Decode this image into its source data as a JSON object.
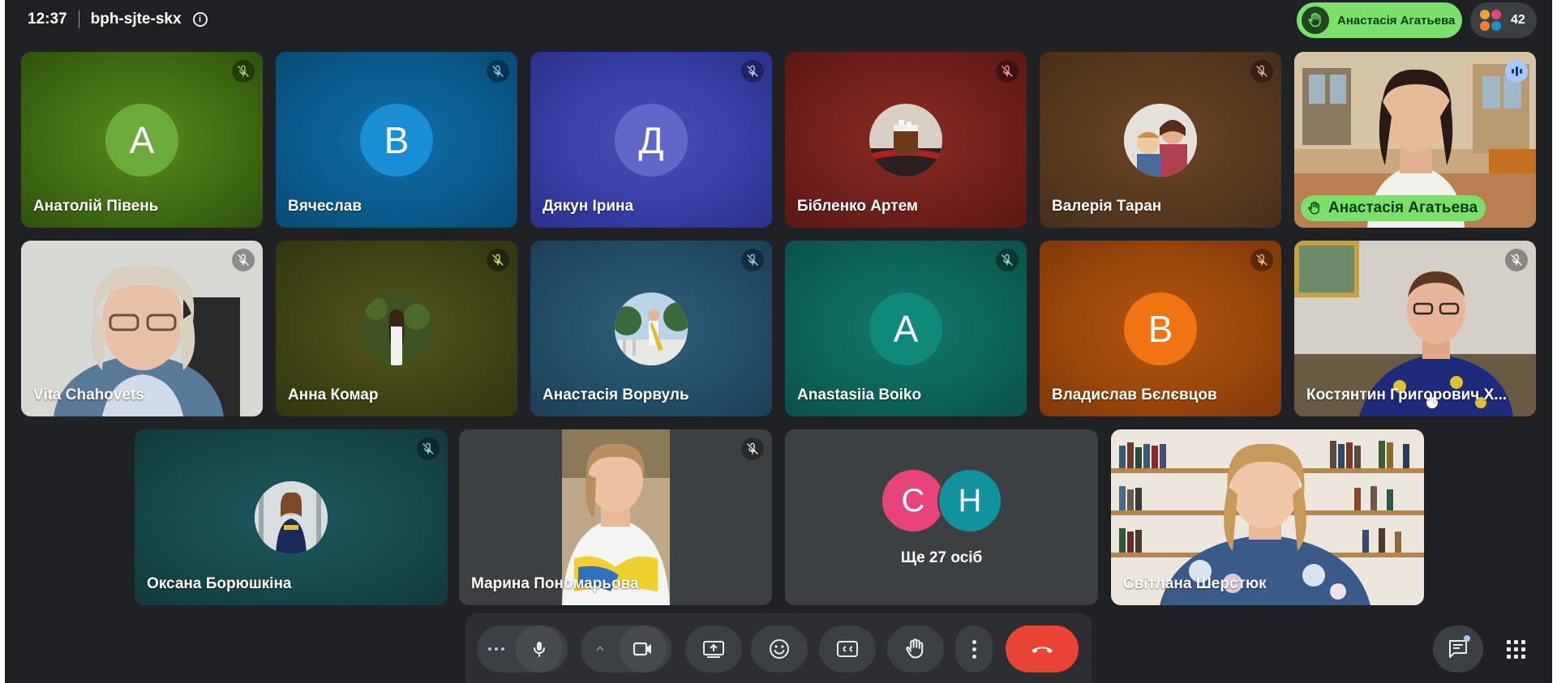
{
  "topbar": {
    "time": "12:37",
    "meeting_code": "bph-sjte-skx"
  },
  "hand_raised": {
    "name": "Анастасія Агатьева"
  },
  "participants_count": "42",
  "tiles": {
    "t1": {
      "name": "Анатолій Півень",
      "initial": "А"
    },
    "t2": {
      "name": "Вячеслав",
      "initial": "В"
    },
    "t3": {
      "name": "Дякун Ірина",
      "initial": "Д"
    },
    "t4": {
      "name": "Бібленко Артем"
    },
    "t5": {
      "name": "Валерія Таран"
    },
    "t6": {
      "name": "Анастасія Агатьева"
    },
    "t7": {
      "name": "Vita Chahovets"
    },
    "t8": {
      "name": "Анна Комар"
    },
    "t9": {
      "name": "Анастасія Ворвуль"
    },
    "t10": {
      "name": "Anastasiia Boiko",
      "initial": "A"
    },
    "t11": {
      "name": "Владислав Бєлєвцов",
      "initial": "В"
    },
    "t12": {
      "name": "Костянтин Григорович Х..."
    },
    "t13": {
      "name": "Оксана Борюшкіна"
    },
    "t14": {
      "name": "Марина Пономарьова"
    },
    "t15": {
      "initials": [
        "С",
        "Н"
      ],
      "label": "Ще 27 осіб"
    },
    "t16": {
      "name": "Світлана Шерстюк"
    }
  },
  "colors": {
    "accent_green": "#7be06a",
    "end_call": "#ea4335",
    "avatar_green": "#6aab3a",
    "avatar_blue": "#1a8fd6",
    "avatar_indigo": "#5f67c8",
    "avatar_teal": "#0f8a78",
    "avatar_orange": "#f07412",
    "avatar_pink": "#e8437a",
    "avatar_cyan": "#12929e"
  }
}
